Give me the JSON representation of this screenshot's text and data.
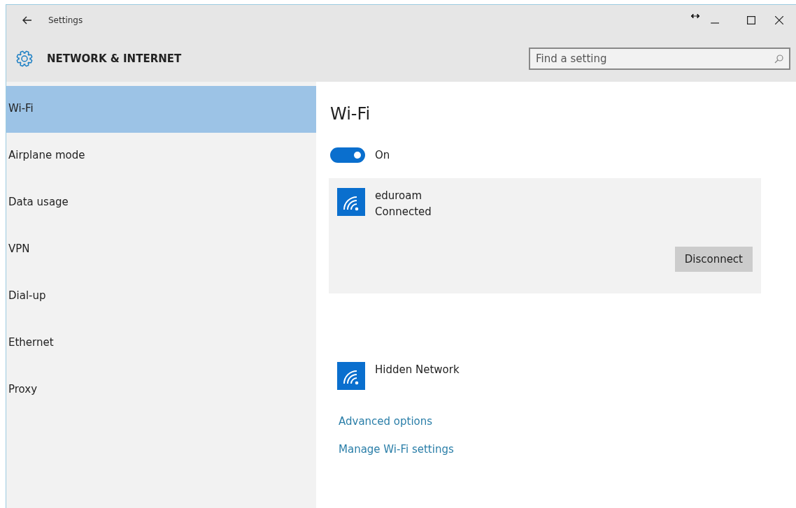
{
  "window": {
    "title": "Settings"
  },
  "header": {
    "title": "NETWORK & INTERNET",
    "search": {
      "placeholder": "Find a setting"
    }
  },
  "sidebar": {
    "items": [
      {
        "label": "Wi-Fi",
        "selected": true
      },
      {
        "label": "Airplane mode",
        "selected": false
      },
      {
        "label": "Data usage",
        "selected": false
      },
      {
        "label": "VPN",
        "selected": false
      },
      {
        "label": "Dial-up",
        "selected": false
      },
      {
        "label": "Ethernet",
        "selected": false
      },
      {
        "label": "Proxy",
        "selected": false
      }
    ]
  },
  "content": {
    "title": "Wi-Fi",
    "toggle": {
      "on": true,
      "label": "On"
    },
    "networks": [
      {
        "name": "eduroam",
        "status": "Connected",
        "selected": true,
        "button": "Disconnect"
      },
      {
        "name": "Hidden Network",
        "selected": false
      }
    ],
    "links": [
      "Advanced options",
      "Manage Wi-Fi settings"
    ]
  }
}
